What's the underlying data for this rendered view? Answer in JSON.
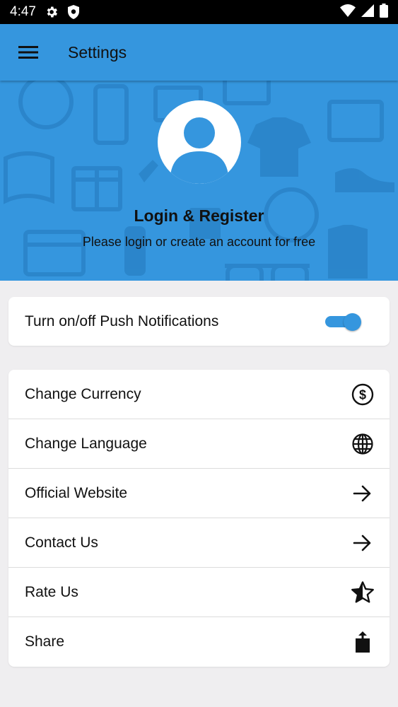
{
  "status_bar": {
    "time": "4:47",
    "left_icons": [
      "gear-icon",
      "shield-icon"
    ],
    "right_icons": [
      "wifi-icon",
      "cell-signal-icon",
      "battery-icon"
    ]
  },
  "app_bar": {
    "title": "Settings",
    "menu_icon": "hamburger-menu-icon",
    "background": "#3596de"
  },
  "header": {
    "avatar_icon": "user-avatar-icon",
    "login_title": "Login & Register",
    "login_subtitle": "Please login or create an account for free"
  },
  "push_notifications": {
    "label": "Turn on/off Push Notifications",
    "enabled": true
  },
  "settings_items": [
    {
      "label": "Change Currency",
      "icon": "dollar-circle-icon"
    },
    {
      "label": "Change Language",
      "icon": "globe-icon"
    },
    {
      "label": "Official Website",
      "icon": "arrow-right-icon"
    },
    {
      "label": "Contact Us",
      "icon": "arrow-right-icon"
    },
    {
      "label": "Rate Us",
      "icon": "star-icon"
    },
    {
      "label": "Share",
      "icon": "share-icon"
    }
  ],
  "colors": {
    "accent": "#3596de",
    "background": "#efeef0",
    "card": "#ffffff",
    "text": "#111111"
  }
}
